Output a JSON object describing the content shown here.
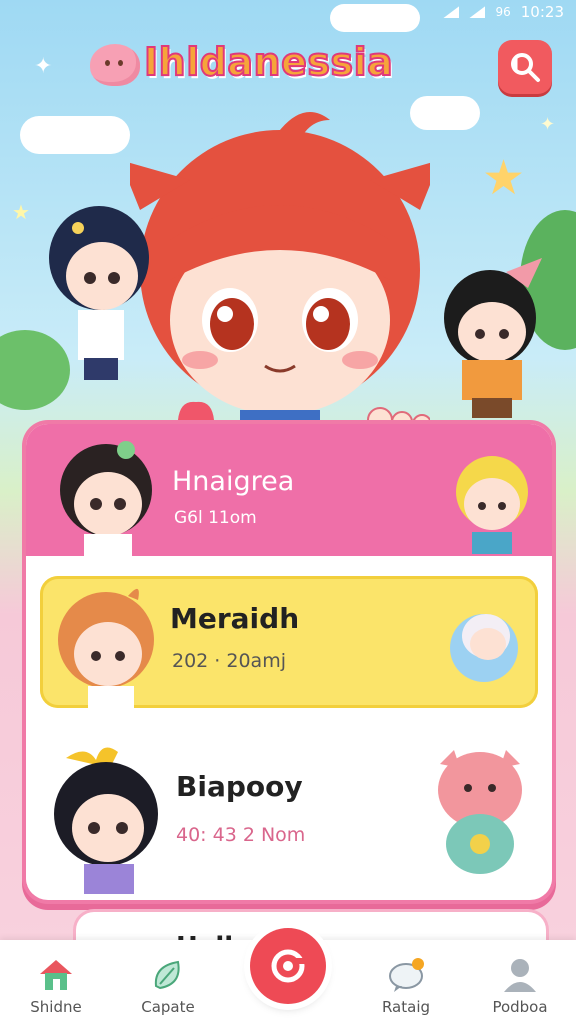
{
  "status_bar": {
    "time": "10:23",
    "battery": "96"
  },
  "header": {
    "title": "Ihldanessia"
  },
  "list": {
    "items": [
      {
        "name": "Hnaigrea",
        "time": "G6l 11om"
      },
      {
        "name": "Meraidh",
        "time": "202 · 20amj"
      },
      {
        "name": "Biapooy",
        "time": "40: 43 2 Nom"
      }
    ],
    "peek_text": "Hella…"
  },
  "nav": {
    "items": [
      {
        "label": "Shidne",
        "icon": "home-icon"
      },
      {
        "label": "Capate",
        "icon": "leaf-icon"
      },
      {
        "label": "Rataig",
        "icon": "chat-icon"
      },
      {
        "label": "Podboa",
        "icon": "profile-icon"
      }
    ],
    "fab_icon": "camera-icon"
  },
  "colors": {
    "accent": "#ee4a55",
    "pink": "#ef6fa8",
    "yellow": "#fbe46a"
  }
}
